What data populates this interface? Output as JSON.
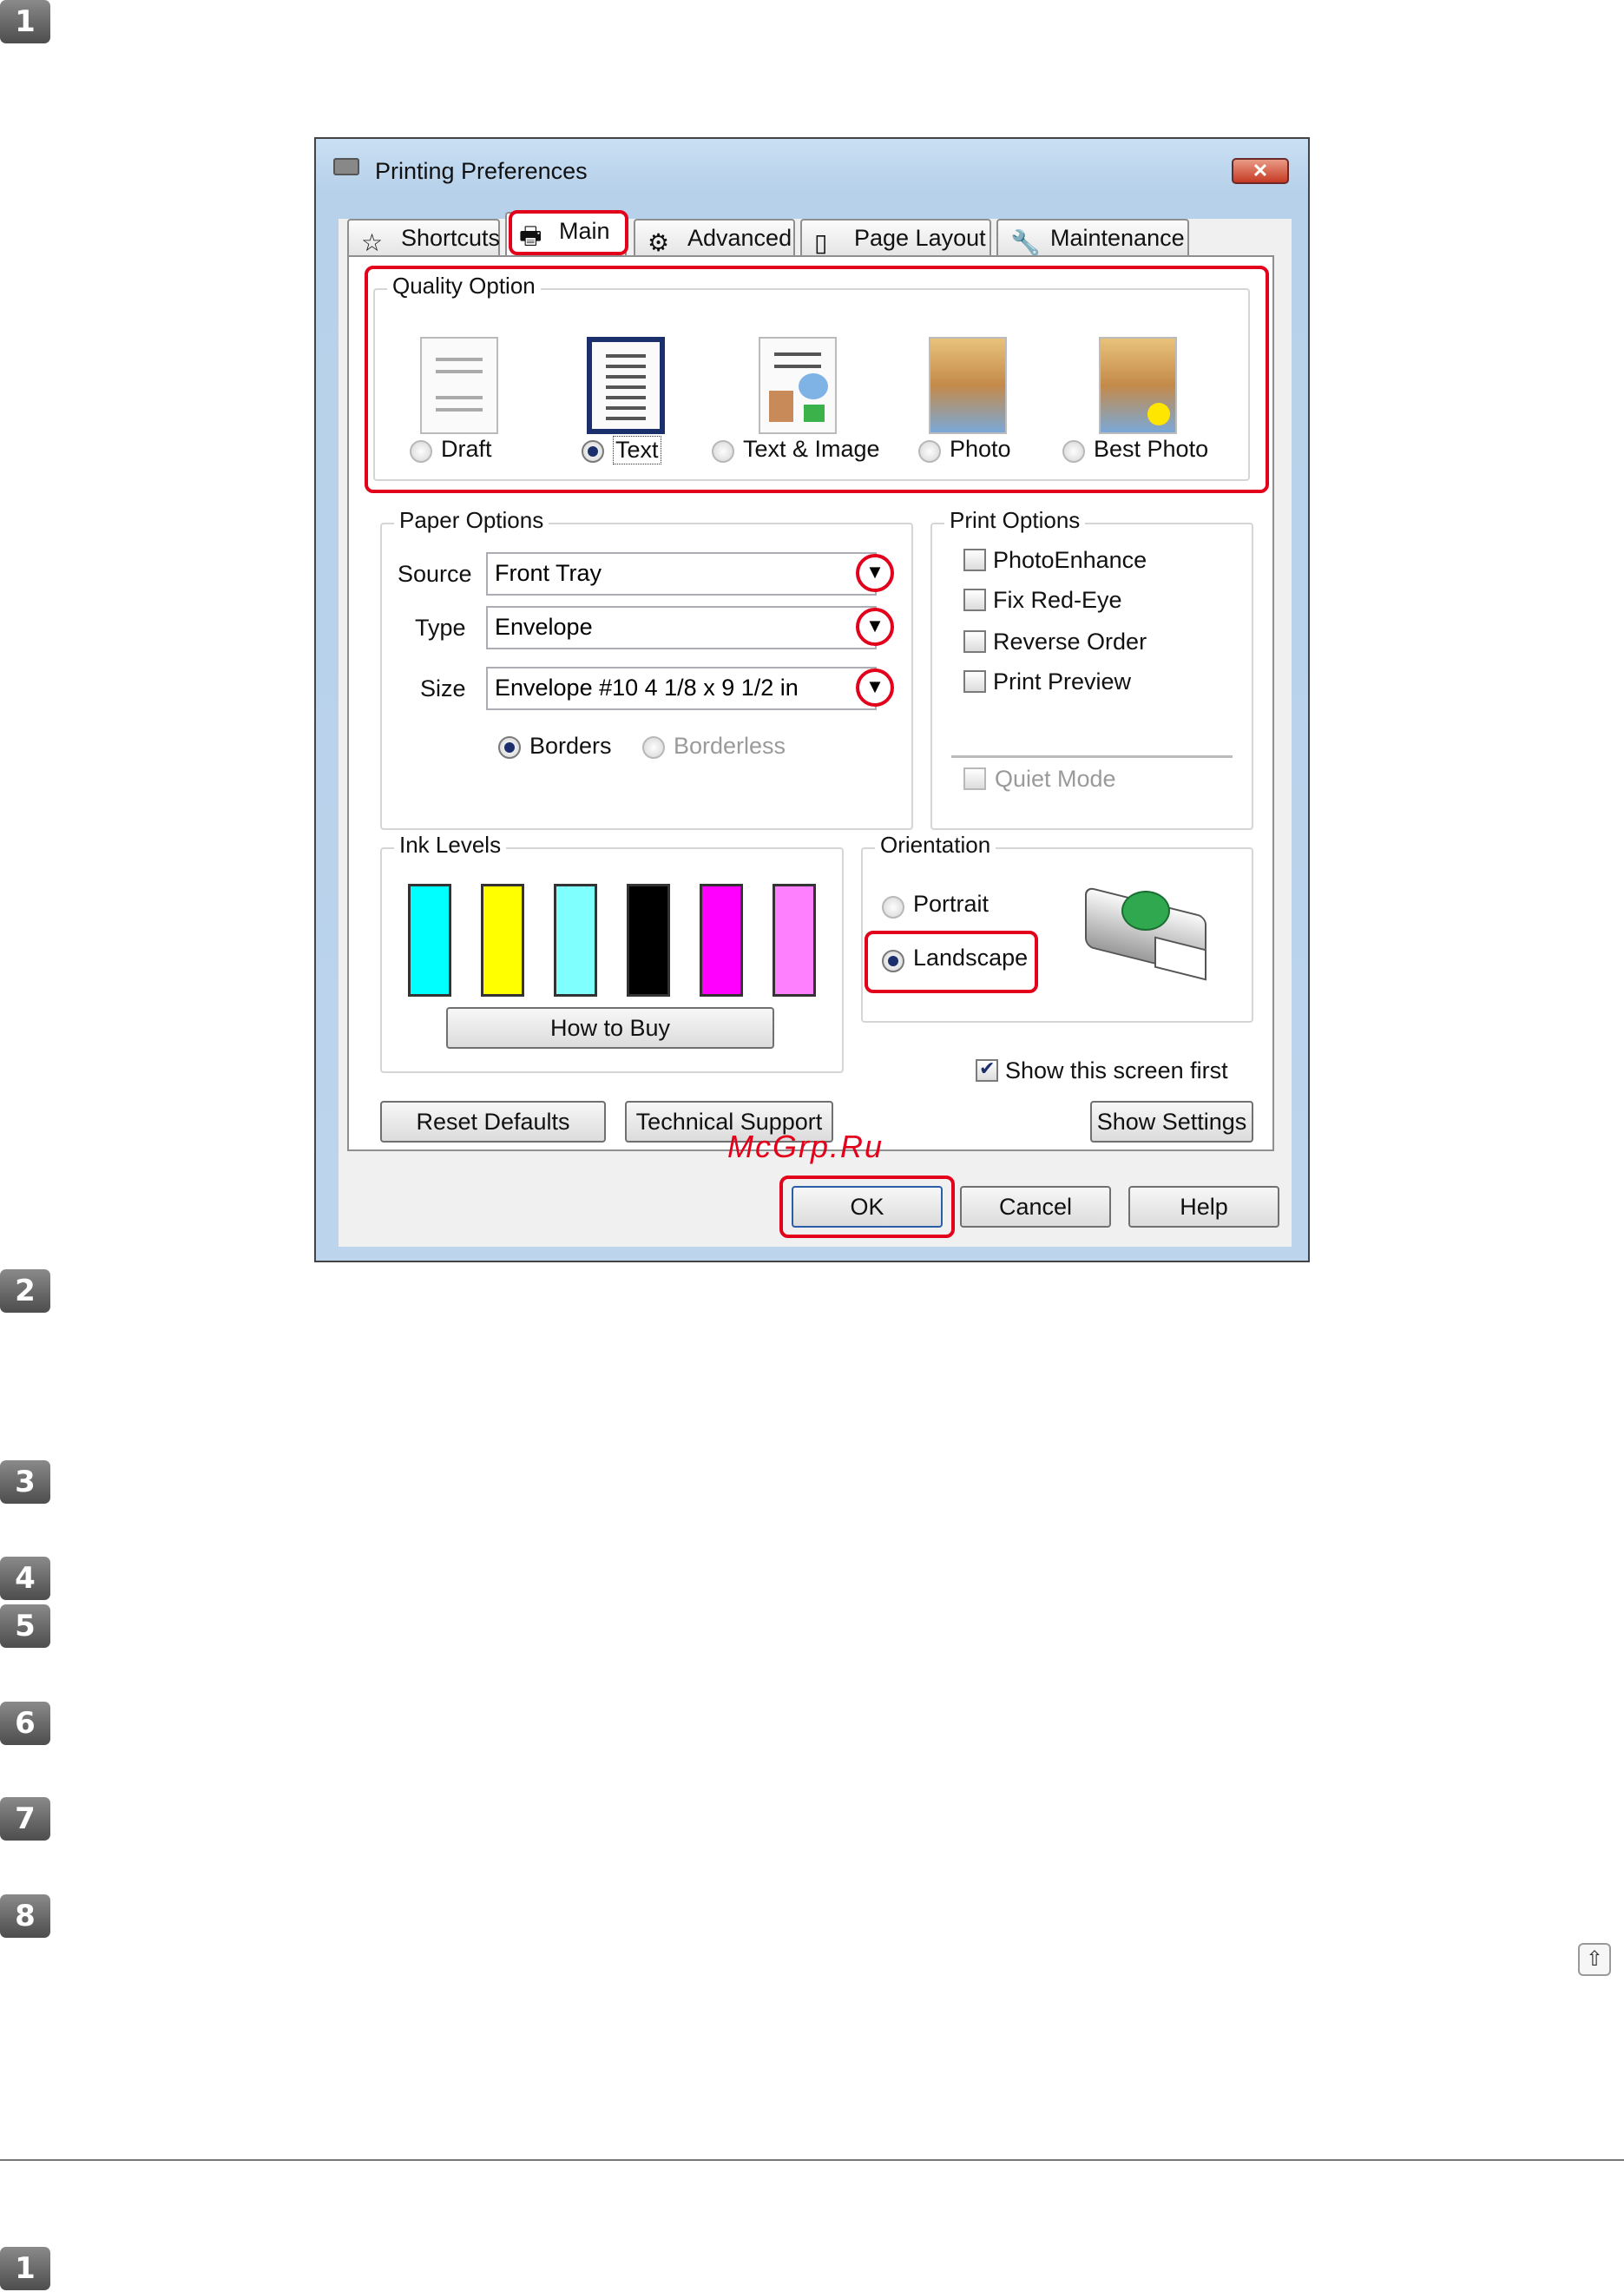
{
  "steps": [
    "1",
    "2",
    "3",
    "4",
    "5",
    "6",
    "7",
    "8",
    "1"
  ],
  "window": {
    "title": "Printing Preferences",
    "close_label": "✕"
  },
  "tabs": [
    {
      "label": "Shortcuts",
      "icon": "star-icon"
    },
    {
      "label": "Main",
      "icon": "printer-icon",
      "active": true
    },
    {
      "label": "Advanced",
      "icon": "advanced-icon"
    },
    {
      "label": "Page Layout",
      "icon": "page-layout-icon"
    },
    {
      "label": "Maintenance",
      "icon": "wrench-icon"
    }
  ],
  "quality": {
    "title": "Quality Option",
    "options": [
      "Draft",
      "Text",
      "Text & Image",
      "Photo",
      "Best Photo"
    ],
    "selected": "Text"
  },
  "paper": {
    "title": "Paper Options",
    "source_label": "Source",
    "source_value": "Front Tray",
    "type_label": "Type",
    "type_value": "Envelope",
    "size_label": "Size",
    "size_value": "Envelope #10 4 1/8 x 9 1/2 in",
    "borders_label": "Borders",
    "borderless_label": "Borderless"
  },
  "print_options": {
    "title": "Print Options",
    "items": [
      "PhotoEnhance",
      "Fix Red-Eye",
      "Reverse Order",
      "Print Preview"
    ],
    "quiet_mode": "Quiet Mode"
  },
  "ink": {
    "title": "Ink Levels",
    "colors": [
      "#00ffff",
      "#ffff00",
      "#80ffff",
      "#000000",
      "#ff00ff",
      "#ff80ff"
    ],
    "how_to_buy": "How to Buy"
  },
  "orientation": {
    "title": "Orientation",
    "portrait": "Portrait",
    "landscape": "Landscape"
  },
  "show_first": "Show this screen first",
  "buttons": {
    "reset": "Reset Defaults",
    "tech_support": "Technical Support",
    "show_settings": "Show Settings",
    "ok": "OK",
    "cancel": "Cancel",
    "help": "Help"
  },
  "watermark": "McGrp.Ru",
  "up_icon": "⇧",
  "accent_red": "#e3001b"
}
